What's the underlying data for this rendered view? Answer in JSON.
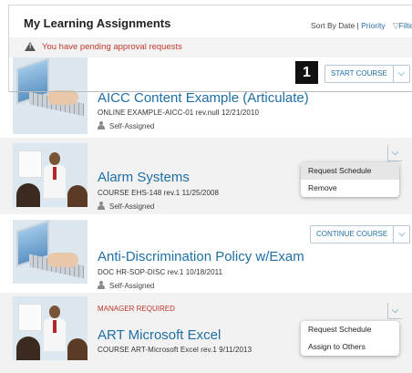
{
  "header": {
    "title": "My Learning Assignments",
    "sort_prefix": "Sort By Date |",
    "sort_link": "Priority",
    "filter_label": "Filte"
  },
  "alert": {
    "text": "You have pending approval requests"
  },
  "annotation": {
    "number": "1"
  },
  "courses": [
    {
      "title": "AICC Content Example (Articulate)",
      "code": "ONLINE EXAMPLE-AICC-01 rev.null 12/21/2010",
      "assignment": "Self-Assigned",
      "action": "START COURSE"
    },
    {
      "title": "Alarm Systems",
      "code": "COURSE EHS-148 rev.1 11/25/2008",
      "assignment": "Self-Assigned",
      "menu": [
        "Request Schedule",
        "Remove"
      ]
    },
    {
      "title": "Anti-Discrimination Policy w/Exam",
      "code": "DOC HR-SOP-DISC rev.1 10/18/2011",
      "assignment": "Self-Assigned",
      "action": "CONTINUE COURSE"
    },
    {
      "flag": "MANAGER REQUIRED",
      "title": "ART Microsoft Excel",
      "code": "COURSE ART-Microsoft Excel rev.1 9/11/2013",
      "menu": [
        "Request Schedule",
        "Assign to Others"
      ]
    }
  ],
  "icons": {
    "alert": "warning-icon",
    "filter": "filter-icon",
    "caret": "chevron-down-icon",
    "person": "person-icon"
  },
  "colors": {
    "link": "#1f6fa5",
    "alert_text": "#c0392b",
    "row_shade": "#f2f2f2",
    "badge": "#111111"
  }
}
